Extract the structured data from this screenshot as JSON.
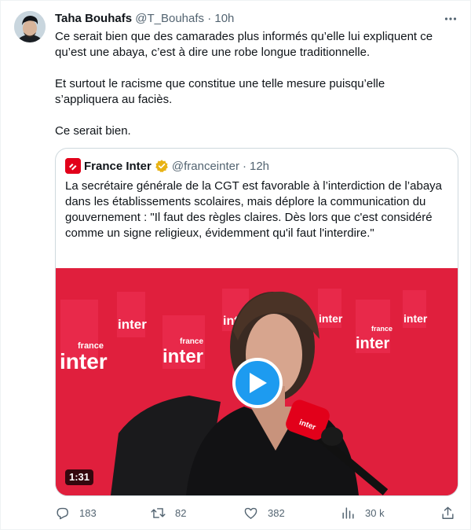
{
  "author": {
    "name": "Taha Bouhafs",
    "handle": "@T_Bouhafs",
    "separator": "·",
    "time": "10h"
  },
  "tweet": {
    "paragraphs": [
      "Ce serait bien que des camarades plus informés qu’elle lui expliquent ce qu’est une abaya, c’est à dire une robe longue traditionnelle.",
      "Et surtout le racisme que constitue une telle mesure puisqu’elle s’appliquera au faciès.",
      "Ce serait bien."
    ]
  },
  "quoted": {
    "name": "France Inter",
    "handle": "@franceinter",
    "separator": "·",
    "time": "12h",
    "text": "La secrétaire générale de la CGT est favorable à l’interdiction de l’abaya dans les établissements scolaires, mais déplore la communication du gouvernement : \"Il faut des règles claires. Dès lors que c'est considéré comme un signe religieux, évidemment qu'il faut l'interdire.\"",
    "media": {
      "duration": "1:31",
      "backdrop_logo_top": "france",
      "backdrop_logo_bottom": "inter",
      "mic_label": "inter"
    }
  },
  "actions": {
    "replies": "183",
    "retweets": "82",
    "likes": "382",
    "views": "30 k"
  },
  "colors": {
    "brand_red": "#e2001a",
    "backdrop_red": "#e01f3d",
    "verified_gold": "#e8b214",
    "play_blue": "#1d9bf0",
    "secondary_text": "#536471"
  },
  "icons": [
    "more-icon",
    "franceinter-logo-icon",
    "verified-badge-icon",
    "play-icon",
    "reply-icon",
    "retweet-icon",
    "like-icon",
    "views-icon",
    "share-icon"
  ]
}
